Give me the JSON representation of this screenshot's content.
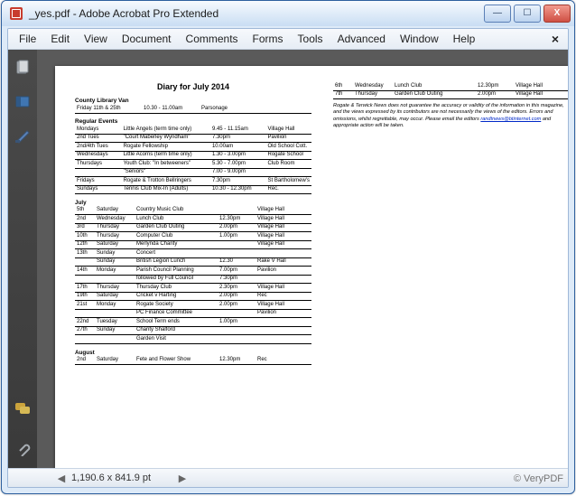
{
  "window": {
    "title": "_yes.pdf - Adobe Acrobat Pro Extended",
    "min": "—",
    "max": "☐",
    "close": "X"
  },
  "menu": {
    "file": "File",
    "edit": "Edit",
    "view": "View",
    "document": "Document",
    "comments": "Comments",
    "forms": "Forms",
    "tools": "Tools",
    "advanced": "Advanced",
    "window": "Window",
    "help": "Help",
    "close_doc": "×"
  },
  "status": {
    "left_arrow": "◀",
    "dimensions": "1,190.6 x 841.9 pt",
    "right_arrow": "▶"
  },
  "watermark": "© VeryPDF",
  "doc": {
    "title": "Diary for July 2014",
    "library_header": "County Library Van",
    "library_row": {
      "days": "Friday  11th & 25th",
      "time": "10.30 - 11.00am",
      "place": "Parsonage"
    },
    "regular_header": "Regular Events",
    "regular": [
      {
        "c1": "Mondays",
        "c2": "Little Angels (term time only)",
        "c3": "9.45 - 11.15am",
        "c4": "Village Hall"
      },
      {
        "c1": "2nd Tues",
        "c2": "\"Court Maberley Wyndham\"",
        "c3": "7.30pm",
        "c4": "Pavilion"
      },
      {
        "c1": "2nd/4th Tues",
        "c2": "Rogate Fellowship",
        "c3": "10.00am",
        "c4": "Old School Cott."
      },
      {
        "c1": "Wednesdays",
        "c2": "Little Acorns (term time only)",
        "c3": "1.30 - 3.00pm",
        "c4": "Rogate School"
      },
      {
        "c1": "Thursdays",
        "c2": "Youth Club: \"In betweeners\"",
        "c3": "5.30 - 7.00pm",
        "c4": "Club Room"
      },
      {
        "c1": "",
        "c2": "\"Seniors\"",
        "c3": "7.00 - 9.00pm",
        "c4": ""
      },
      {
        "c1": "Fridays",
        "c2": "Rogate & Trotton Bellringers",
        "c3": "7.30pm",
        "c4": "St Bartholomew's"
      },
      {
        "c1": "Sundays",
        "c2": "Tennis Club Mix-In (Adults)",
        "c3": "10.30 - 12.30pm",
        "c4": "Rec."
      }
    ],
    "july_header": "July",
    "july": [
      {
        "c1": "5th",
        "c2": "Saturday",
        "c3": "Country Music Club",
        "c4": "",
        "c5": "Village Hall"
      },
      {
        "c1": "2nd",
        "c2": "Wednesday",
        "c3": "Lunch Club",
        "c4": "12.30pm",
        "c5": "Village Hall"
      },
      {
        "c1": "3rd",
        "c2": "Thursday",
        "c3": "Garden Club Outing",
        "c4": "2.00pm",
        "c5": "Village Hall"
      },
      {
        "c1": "10th",
        "c2": "Thursday",
        "c3": "Computer Club",
        "c4": "1.00pm",
        "c5": "Village Hall"
      },
      {
        "c1": "12th",
        "c2": "Saturday",
        "c3": "Merlynda Charity",
        "c4": "",
        "c5": "Village Hall"
      },
      {
        "c1": "13th",
        "c2": "Sunday",
        "c3": "Concert",
        "c4": "",
        "c5": ""
      },
      {
        "c1": "",
        "c2": "Sunday",
        "c3": "British Legion Lunch",
        "c4": "12.30",
        "c5": "Rake V Hall"
      },
      {
        "c1": "14th",
        "c2": "Monday",
        "c3": "Parish Council Planning",
        "c4": "7.00pm",
        "c5": "Pavilion"
      },
      {
        "c1": "",
        "c2": "",
        "c3": "followed by Full Council",
        "c4": "7:30pm",
        "c5": ""
      },
      {
        "c1": "17th",
        "c2": "Thursday",
        "c3": "Thursday Club",
        "c4": "2.30pm",
        "c5": "Village Hall"
      },
      {
        "c1": "19th",
        "c2": "Saturday",
        "c3": "Cricket v Harting",
        "c4": "2.00pm",
        "c5": "Rec"
      },
      {
        "c1": "21st",
        "c2": "Monday",
        "c3": "Rogate Society",
        "c4": "2.00pm",
        "c5": "Village Hall"
      },
      {
        "c1": "",
        "c2": "",
        "c3": "PC Finance Committee",
        "c4": "",
        "c5": "Pavilion"
      },
      {
        "c1": "22nd",
        "c2": "Tuesday",
        "c3": "School Term ends",
        "c4": "1.00pm",
        "c5": ""
      },
      {
        "c1": "27th",
        "c2": "Sunday",
        "c3": "Charity Shalford",
        "c4": "",
        "c5": ""
      },
      {
        "c1": "",
        "c2": "",
        "c3": "Garden Visit",
        "c4": "",
        "c5": ""
      }
    ],
    "august_header": "August",
    "august": [
      {
        "c1": "2nd",
        "c2": "Saturday",
        "c3": "Fete and Flower Show",
        "c4": "12.30pm",
        "c5": "Rec"
      }
    ],
    "col2rows": [
      {
        "c1": "6th",
        "c2": "Wednesday",
        "c3": "Lunch Club",
        "c4": "12.30pm",
        "c5": "Village Hall"
      },
      {
        "c1": "7th",
        "c2": "Thursday",
        "c3": "Garden Club Outing",
        "c4": "2.00pm",
        "c5": "Village Hall"
      }
    ],
    "disclaimer_1": "Rogate & Terwick News does not guarantee the accuracy or validity of the information in this magazine, and the views expressed by its contributors are not necessarily the views of the editors. Errors and omissions, whilst regrettable, may occur. Please email the editors ",
    "disclaimer_link": "randtnews@btinternet.com",
    "disclaimer_2": " and appropriate action will be taken."
  }
}
